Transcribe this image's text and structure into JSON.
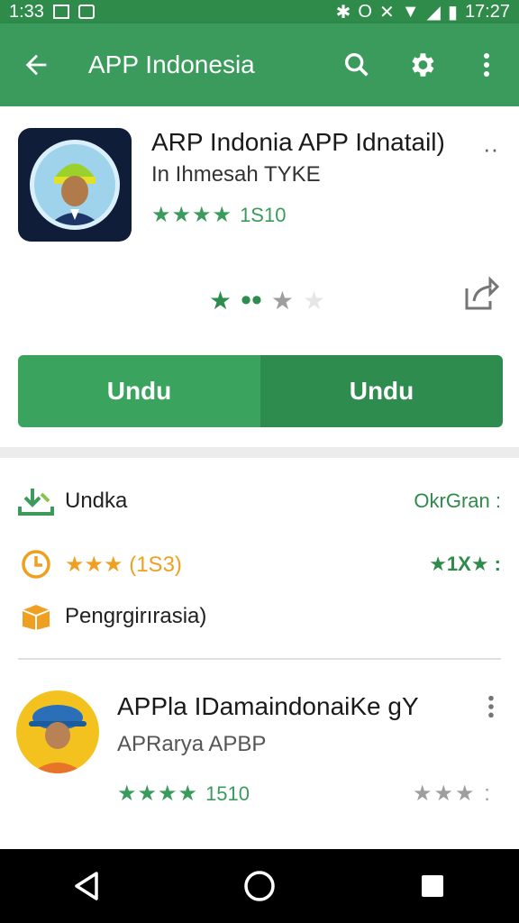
{
  "status": {
    "time_left": "1:33",
    "time_right": "17:27"
  },
  "appbar": {
    "title": "APP Indonesia",
    "icons": [
      "back-arrow-icon",
      "search-icon",
      "gear-icon",
      "more-vert-icon"
    ]
  },
  "app": {
    "name": "ARP Indonia APP Idnatail)",
    "subtitle": "In Ihmesah TYKE",
    "stars": "★★★★",
    "rating_count": "1S10",
    "pager": {
      "active": "★",
      "dots": "••",
      "star_dim": "★",
      "star_light": "★"
    }
  },
  "buttons": {
    "left_label": "Undu",
    "right_label": "Undu"
  },
  "info_rows": [
    {
      "icon": "download-icon",
      "label": "Undka",
      "right": "OkrGran :"
    },
    {
      "icon": "clock-icon",
      "label": "★★★ (1S3)",
      "right": "★1X★ :"
    },
    {
      "icon": "package-icon",
      "label": "Pengrgirırasia)",
      "right": ""
    }
  ],
  "app2": {
    "name": "APPla IDamaindonaiKe gY",
    "subtitle": "APRarya APBP",
    "stars": "★★★★",
    "rating_count": "1510",
    "right_stars": "★★★ :"
  },
  "colors": {
    "primary": "#3a9b5c",
    "primary_dark": "#2d8c4e",
    "status_bar": "#2e8b4a",
    "star_orange": "#f0a020"
  }
}
